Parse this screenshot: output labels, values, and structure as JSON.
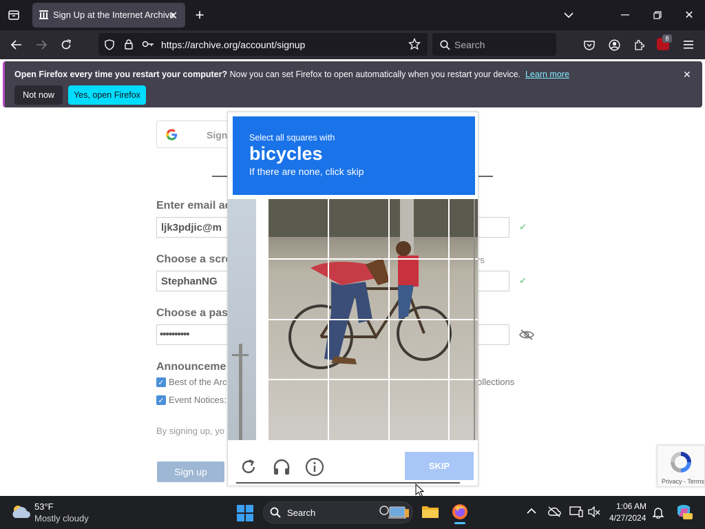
{
  "browser": {
    "tab_title": "Sign Up at the Internet Archive",
    "url": "https://archive.org/account/signup",
    "search_placeholder": "Search",
    "extension_badge": "8"
  },
  "notification": {
    "bold": "Open Firefox every time you restart your computer?",
    "text": " Now you can set Firefox to open automatically when you restart your device.",
    "link": "Learn more",
    "not_now": "Not now",
    "yes": "Yes, open Firefox"
  },
  "signup": {
    "google_label": "Sign",
    "email_label": "Enter email ac",
    "email_value": "ljk3pdjic@m",
    "screen_label": "Choose a scre",
    "screen_value": "StephanNG",
    "screen_hint_tail": "rs",
    "password_label": "Choose a pas",
    "password_value": "••••••••••",
    "announce_label": "Announceme",
    "check1": "Best of the Arc",
    "check1_tail": "ollections",
    "check2": "Event Notices:",
    "terms": "By signing up, yo",
    "submit": "Sign up"
  },
  "captcha": {
    "instruction": "Select all squares with",
    "target": "bicycles",
    "hint": "If there are none, click skip",
    "skip": "SKIP"
  },
  "recaptcha": {
    "links": "Privacy - Terms"
  },
  "taskbar": {
    "temperature": "53°F",
    "weather": "Mostly cloudy",
    "search": "Search",
    "time": "1:06 AM",
    "date": "4/27/2024"
  },
  "colors": {
    "accent": "#1a73e8",
    "skip": "#a8c6f7",
    "firefox_cta": "#00ddff"
  }
}
